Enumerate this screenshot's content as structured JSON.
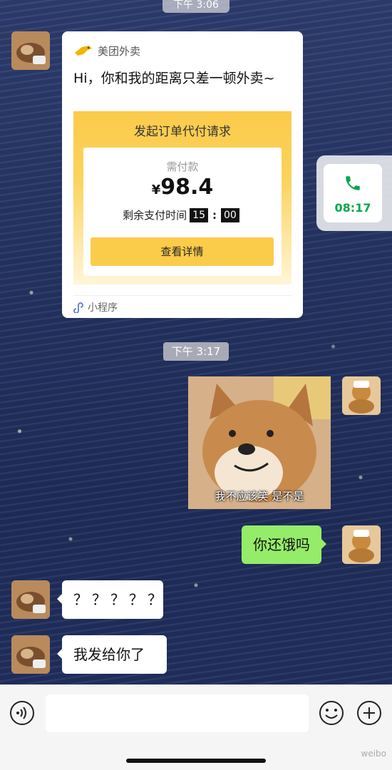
{
  "top_time": "下午 3:06",
  "card": {
    "source": "美团外卖",
    "title": "Hi，你和我的距离只差一顿外卖~",
    "pay_title": "发起订单代付请求",
    "need_label": "需付款",
    "currency": "¥",
    "amount": "98.4",
    "remain_label": "剩余支付时间",
    "remain_min": "15",
    "remain_sep": ":",
    "remain_sec": "00",
    "button": "查看详情",
    "footer": "小程序"
  },
  "call": {
    "duration": "08:17",
    "icon": "phone-icon"
  },
  "timestamp": "下午 3:17",
  "sticker_caption": "我不应该笑 是不是",
  "messages": {
    "sent_text": "你还饿吗",
    "recv_1": "？？？？？",
    "recv_2": "我发给你了"
  },
  "bottom_bar": {
    "voice_icon": "voice-icon",
    "emoji_icon": "emoji-icon",
    "plus_icon": "plus-icon"
  },
  "watermark": "weibo",
  "colors": {
    "sent_bubble": "#95ec69",
    "meituan_yellow": "#fbcb4a",
    "call_green": "#07a84b"
  }
}
